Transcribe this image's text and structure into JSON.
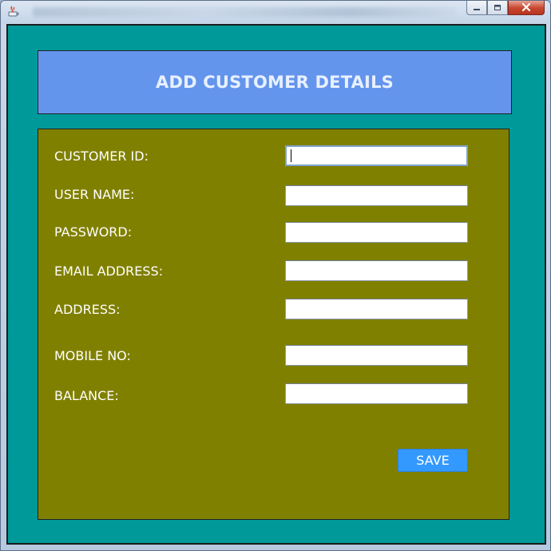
{
  "window": {
    "title": "",
    "controls": {
      "minimize": "minimize-icon",
      "maximize": "maximize-icon",
      "close": "close-icon"
    }
  },
  "header": {
    "title": "ADD CUSTOMER DETAILS"
  },
  "form": {
    "fields": [
      {
        "label": "CUSTOMER ID:",
        "value": ""
      },
      {
        "label": "USER NAME:",
        "value": ""
      },
      {
        "label": "PASSWORD:",
        "value": ""
      },
      {
        "label": "EMAIL ADDRESS:",
        "value": ""
      },
      {
        "label": "ADDRESS:",
        "value": ""
      },
      {
        "label": "MOBILE NO:",
        "value": ""
      },
      {
        "label": "BALANCE:",
        "value": ""
      }
    ],
    "save_label": "SAVE"
  },
  "colors": {
    "frame_background": "#009999",
    "header_background": "#6495ED",
    "form_background": "#808000",
    "save_button": "#3399FF",
    "text": "#FFFFFF"
  }
}
